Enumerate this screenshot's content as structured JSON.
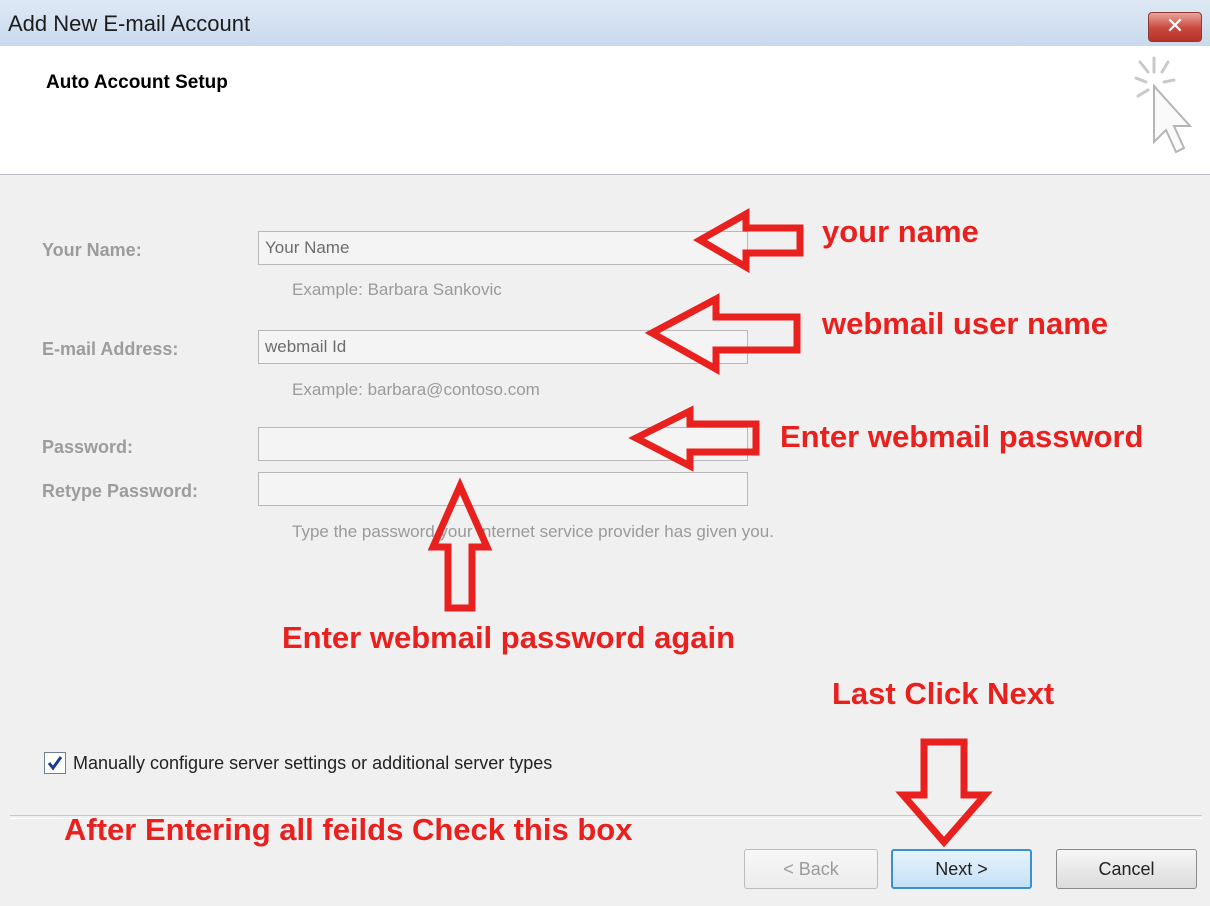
{
  "window": {
    "title": "Add New E-mail Account",
    "close_label": "✕"
  },
  "header": {
    "title": "Auto Account Setup",
    "icon": "cursor-click-icon"
  },
  "form": {
    "name_label": "Your Name:",
    "name_value": "Your Name",
    "name_example": "Example: Barbara Sankovic",
    "email_label": "E-mail Address:",
    "email_value": "webmail Id",
    "email_example": "Example: barbara@contoso.com",
    "password_label": "Password:",
    "password_value": "",
    "retype_label": "Retype Password:",
    "retype_value": "",
    "password_hint": "Type the password your Internet service provider has given you."
  },
  "manual_config": {
    "checked": true,
    "label": "Manually configure server settings or additional server types"
  },
  "buttons": {
    "back": "< Back",
    "next": "Next >",
    "cancel": "Cancel"
  },
  "annotations": {
    "your_name": "your name",
    "user_name": "webmail user name",
    "password": "Enter webmail password",
    "password_again": "Enter webmail password again",
    "last_click": "Last Click Next",
    "check_box": "After Entering all feilds Check this box"
  },
  "colors": {
    "annotation": "#e8211f",
    "body_background": "#f0f0f0",
    "next_border": "#3c90d2"
  }
}
